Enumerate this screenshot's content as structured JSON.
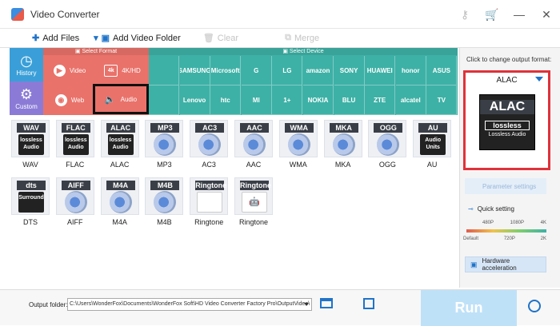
{
  "window": {
    "title": "Video Converter"
  },
  "toolbar": {
    "add_files": "Add Files",
    "add_video_folder": "Add Video Folder",
    "clear": "Clear",
    "merge": "Merge"
  },
  "format_panel": {
    "select_format": "Select Format",
    "select_device": "Select Device",
    "history": "History",
    "custom": "Custom",
    "video": "Video",
    "hd": "4K/HD",
    "web": "Web",
    "audio": "Audio",
    "hd_icon": "4k"
  },
  "devices": {
    "row1": [
      "",
      "SAMSUNG",
      "Microsoft",
      "G",
      "LG",
      "amazon",
      "SONY",
      "HUAWEI",
      "honor",
      "ASUS"
    ],
    "row2": [
      "",
      "Lenovo",
      "htc",
      "MI",
      "1+",
      "NOKIA",
      "BLU",
      "ZTE",
      "alcatel",
      "TV"
    ]
  },
  "formats": [
    {
      "label": "WAV",
      "body": "lossless Audio",
      "name": "WAV"
    },
    {
      "label": "FLAC",
      "body": "lossless Audio",
      "name": "FLAC"
    },
    {
      "label": "ALAC",
      "body": "lossless Audio",
      "name": "ALAC"
    },
    {
      "label": "MP3",
      "body": "",
      "name": "MP3"
    },
    {
      "label": "AC3",
      "body": "",
      "name": "AC3"
    },
    {
      "label": "AAC",
      "body": "",
      "name": "AAC"
    },
    {
      "label": "WMA",
      "body": "",
      "name": "WMA"
    },
    {
      "label": "MKA",
      "body": "",
      "name": "MKA"
    },
    {
      "label": "OGG",
      "body": "",
      "name": "OGG"
    },
    {
      "label": "AU",
      "body": "Audio Units",
      "name": "AU"
    },
    {
      "label": "dts",
      "body": "Surround",
      "name": "DTS"
    },
    {
      "label": "AIFF",
      "body": "",
      "name": "AIFF"
    },
    {
      "label": "M4A",
      "body": "",
      "name": "M4A"
    },
    {
      "label": "M4B",
      "body": "",
      "name": "M4B"
    },
    {
      "label": "Ringtone",
      "body": "",
      "name": "Ringtone"
    },
    {
      "label": "Ringtone",
      "body": "",
      "name": "Ringtone"
    }
  ],
  "right_panel": {
    "title": "Click to change output format:",
    "selected_format": "ALAC",
    "big_label": "ALAC",
    "big_sub1": "lossless",
    "big_sub2": "Lossless Audio",
    "parameter_settings": "Parameter settings",
    "quick_setting": "Quick setting",
    "top_ticks": [
      "480P",
      "1080P",
      "4K"
    ],
    "bottom_ticks": [
      "Default",
      "720P",
      "2K"
    ],
    "hardware_acceleration": "Hardware acceleration"
  },
  "bottom": {
    "output_folder_label": "Output folder:",
    "output_folder_path": "C:\\Users\\WonderFox\\Documents\\WonderFox Soft\\HD Video Converter Factory Pro\\OutputVideo\\",
    "run": "Run"
  },
  "colors": {
    "format_red": "#e9726a",
    "device_teal": "#3eb1a6",
    "history_blue": "#3a9fd8",
    "custom_purple": "#8b7bd6",
    "highlight_red": "#e0323a",
    "run_blue": "#bfe1f8"
  }
}
